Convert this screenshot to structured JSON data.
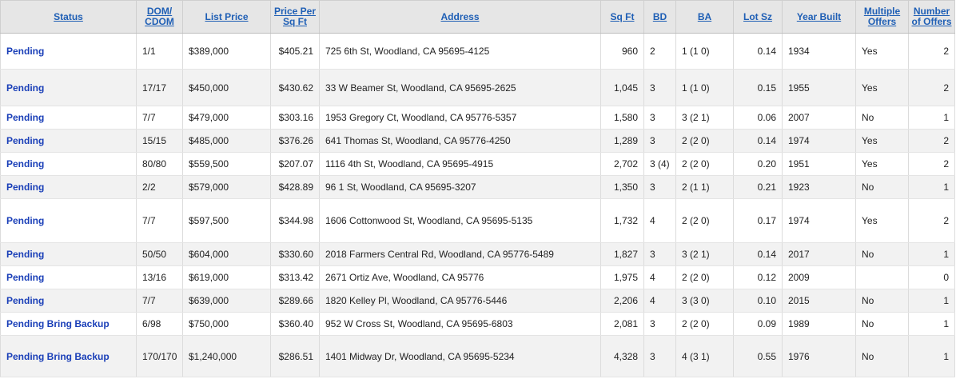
{
  "headers": {
    "status": "Status",
    "dom": "DOM/ CDOM",
    "list_price": "List Price",
    "price_per_sqft": "Price Per Sq Ft",
    "address": "Address",
    "sqft": "Sq Ft",
    "bd": "BD",
    "ba": "BA",
    "lot": "Lot Sz",
    "year": "Year Built",
    "multiple_offers": "Multiple Offers",
    "num_offers": "Number of Offers"
  },
  "rows": [
    {
      "status": "Pending",
      "dom": "1/1",
      "price": "$389,000",
      "ppsf": "$405.21",
      "address": "725 6th St, Woodland, CA 95695-4125",
      "sqft": "960",
      "bd": "2",
      "ba": "1 (1 0)",
      "lot": "0.14",
      "year": "1934",
      "multi": "Yes",
      "offers": "2"
    },
    {
      "status": "Pending",
      "dom": "17/17",
      "price": "$450,000",
      "ppsf": "$430.62",
      "address": "33 W Beamer St, Woodland, CA 95695-2625",
      "sqft": "1,045",
      "bd": "3",
      "ba": "1 (1 0)",
      "lot": "0.15",
      "year": "1955",
      "multi": "Yes",
      "offers": "2"
    },
    {
      "status": "Pending",
      "dom": "7/7",
      "price": "$479,000",
      "ppsf": "$303.16",
      "address": "1953 Gregory Ct, Woodland, CA 95776-5357",
      "sqft": "1,580",
      "bd": "3",
      "ba": "3 (2 1)",
      "lot": "0.06",
      "year": "2007",
      "multi": "No",
      "offers": "1"
    },
    {
      "status": "Pending",
      "dom": "15/15",
      "price": "$485,000",
      "ppsf": "$376.26",
      "address": "641 Thomas St, Woodland, CA 95776-4250",
      "sqft": "1,289",
      "bd": "3",
      "ba": "2 (2 0)",
      "lot": "0.14",
      "year": "1974",
      "multi": "Yes",
      "offers": "2"
    },
    {
      "status": "Pending",
      "dom": "80/80",
      "price": "$559,500",
      "ppsf": "$207.07",
      "address": "1116 4th St, Woodland, CA 95695-4915",
      "sqft": "2,702",
      "bd": "3 (4)",
      "ba": "2 (2 0)",
      "lot": "0.20",
      "year": "1951",
      "multi": "Yes",
      "offers": "2"
    },
    {
      "status": "Pending",
      "dom": "2/2",
      "price": "$579,000",
      "ppsf": "$428.89",
      "address": "96 1 St, Woodland, CA 95695-3207",
      "sqft": "1,350",
      "bd": "3",
      "ba": "2 (1 1)",
      "lot": "0.21",
      "year": "1923",
      "multi": "No",
      "offers": "1"
    },
    {
      "status": "Pending",
      "dom": "7/7",
      "price": "$597,500",
      "ppsf": "$344.98",
      "address": "1606 Cottonwood St, Woodland, CA 95695-5135",
      "sqft": "1,732",
      "bd": "4",
      "ba": "2 (2 0)",
      "lot": "0.17",
      "year": "1974",
      "multi": "Yes",
      "offers": "2"
    },
    {
      "status": "Pending",
      "dom": "50/50",
      "price": "$604,000",
      "ppsf": "$330.60",
      "address": "2018 Farmers Central Rd, Woodland, CA 95776-5489",
      "sqft": "1,827",
      "bd": "3",
      "ba": "3 (2 1)",
      "lot": "0.14",
      "year": "2017",
      "multi": "No",
      "offers": "1"
    },
    {
      "status": "Pending",
      "dom": "13/16",
      "price": "$619,000",
      "ppsf": "$313.42",
      "address": "2671 Ortiz Ave, Woodland, CA 95776",
      "sqft": "1,975",
      "bd": "4",
      "ba": "2 (2 0)",
      "lot": "0.12",
      "year": "2009",
      "multi": "",
      "offers": "0"
    },
    {
      "status": "Pending",
      "dom": "7/7",
      "price": "$639,000",
      "ppsf": "$289.66",
      "address": "1820 Kelley Pl, Woodland, CA 95776-5446",
      "sqft": "2,206",
      "bd": "4",
      "ba": "3 (3 0)",
      "lot": "0.10",
      "year": "2015",
      "multi": "No",
      "offers": "1"
    },
    {
      "status": "Pending Bring Backup",
      "dom": "6/98",
      "price": "$750,000",
      "ppsf": "$360.40",
      "address": "952 W Cross St, Woodland, CA 95695-6803",
      "sqft": "2,081",
      "bd": "3",
      "ba": "2 (2 0)",
      "lot": "0.09",
      "year": "1989",
      "multi": "No",
      "offers": "1"
    },
    {
      "status": "Pending Bring Backup",
      "dom": "170/170",
      "price": "$1,240,000",
      "ppsf": "$286.51",
      "address": "1401 Midway Dr, Woodland, CA 95695-5234",
      "sqft": "4,328",
      "bd": "3",
      "ba": "4 (3 1)",
      "lot": "0.55",
      "year": "1976",
      "multi": "No",
      "offers": "1"
    }
  ]
}
